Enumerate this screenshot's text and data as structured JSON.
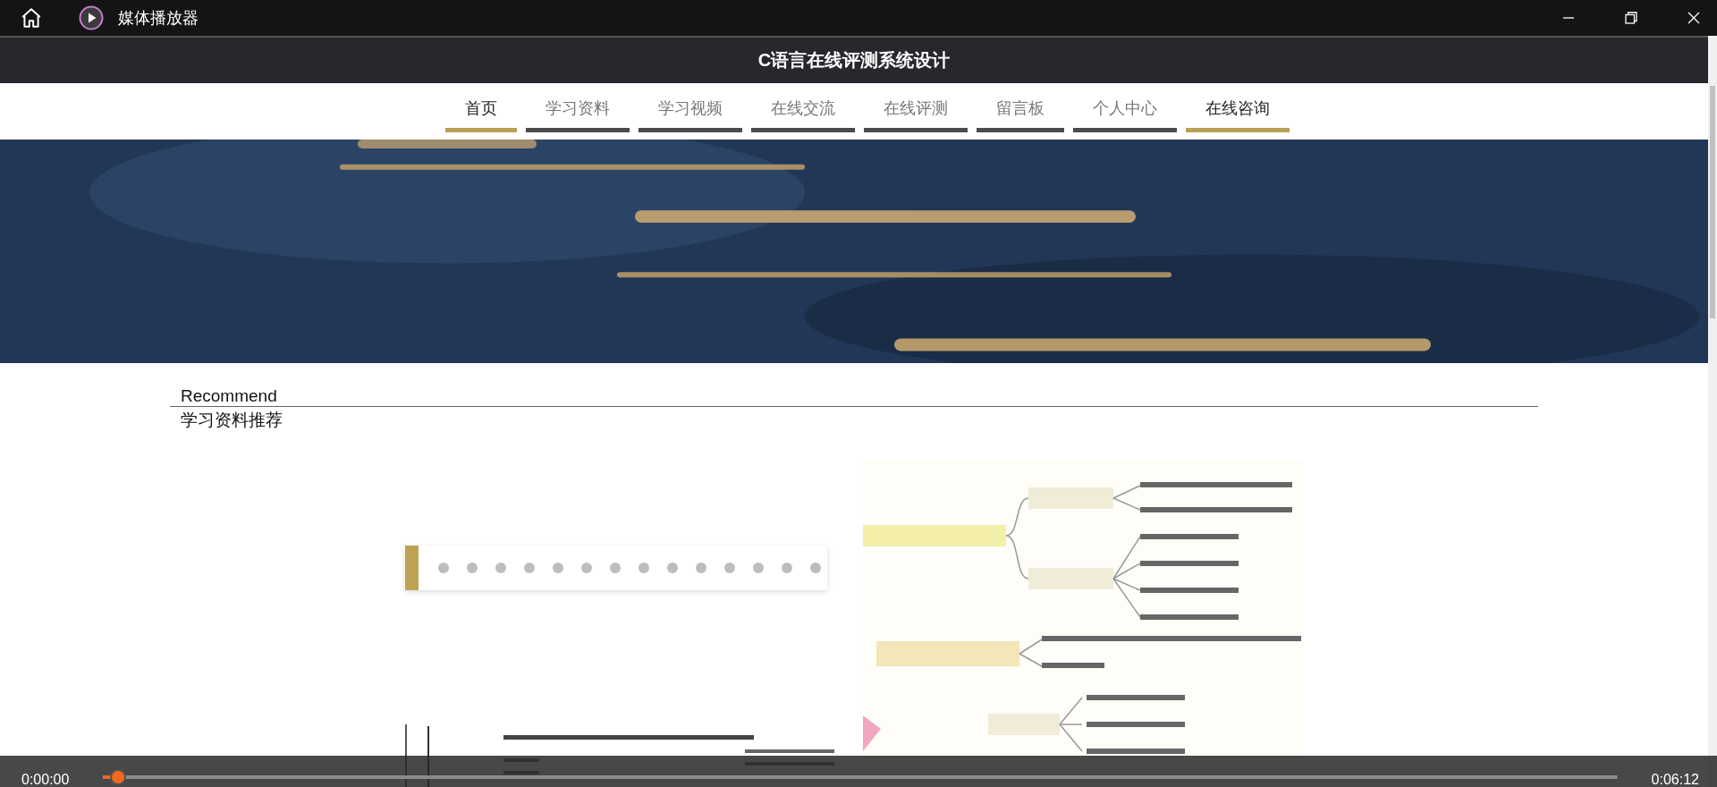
{
  "window": {
    "title": "媒体播放器"
  },
  "site": {
    "title": "C语言在线评测系统设计",
    "nav": [
      {
        "label": "首页",
        "selected": true
      },
      {
        "label": "学习资料",
        "selected": false
      },
      {
        "label": "学习视频",
        "selected": false
      },
      {
        "label": "在线交流",
        "selected": false
      },
      {
        "label": "在线评测",
        "selected": false
      },
      {
        "label": "留言板",
        "selected": false
      },
      {
        "label": "个人中心",
        "selected": false
      },
      {
        "label": "在线咨询",
        "selected": true
      }
    ],
    "section": {
      "heading": "Recommend",
      "subheading": "学习资料推荐"
    }
  },
  "player": {
    "elapsed": "0:00:00",
    "total": "0:06:12",
    "level": 0.01
  }
}
